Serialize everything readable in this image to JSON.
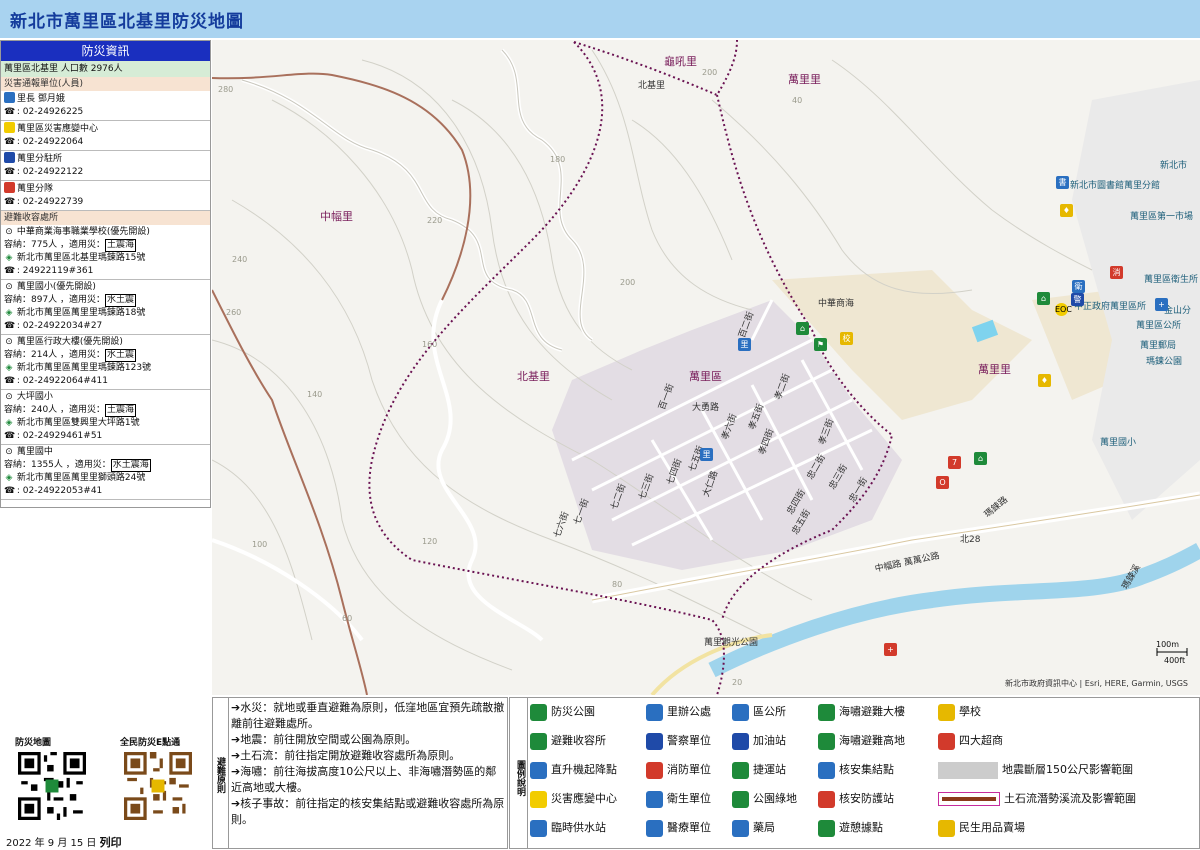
{
  "title": "新北市萬里區北基里防災地圖",
  "panel": {
    "heading": "防災資訊",
    "population": "萬里區北基里  人口數   2976人",
    "report_section": "災害通報單位(人員)",
    "contacts": [
      {
        "name": "里長 鄧月娥",
        "phone": "02-24926225",
        "icon": "village-office-icon",
        "color": "#2a6fc0"
      },
      {
        "name": "萬里區災害應變中心",
        "phone": "02-24922064",
        "icon": "eoc-icon",
        "color": "#f2cc00"
      },
      {
        "name": "萬里分駐所",
        "phone": "02-24922122",
        "icon": "police-icon",
        "color": "#1f4aa8"
      },
      {
        "name": "萬里分隊",
        "phone": "02-24922739",
        "icon": "fire-station-icon",
        "color": "#d23a2b"
      }
    ],
    "shelter_section": "避難收容處所",
    "shelters": [
      {
        "name": "中華商業海事職業學校(優先開設)",
        "capacity": "容納：775人 ，適用災：",
        "hazards": "土震海",
        "address": "新北市萬里區北基里瑪鋉路15號",
        "phone": "24922119#361"
      },
      {
        "name": "萬里國小(優先開設)",
        "capacity": "容納：897人 ，適用災：",
        "hazards": "水土震",
        "address": "新北市萬里區萬里里瑪鋉路18號",
        "phone": "02-24922034#27"
      },
      {
        "name": "萬里區行政大樓(優先開設)",
        "capacity": "容納：214人 ，適用災：",
        "hazards": "水土震",
        "address": "新北市萬里區萬里里瑪鋉路123號",
        "phone": "02-24922064#411"
      },
      {
        "name": "大坪國小",
        "capacity": "容納：240人 ，適用災：",
        "hazards": "土震海",
        "address": "新北市萬里區雙興里大坪路1號",
        "phone": "02-24929461#51"
      },
      {
        "name": "萬里國中",
        "capacity": "容納：1355人 ，適用災：",
        "hazards": "水土震海",
        "address": "新北市萬里區萬里里獅頭路24號",
        "phone": "02-24922053#41"
      }
    ]
  },
  "map": {
    "villages": [
      "龜吼里",
      "萬里里",
      "北基里",
      "中幅里",
      "萬里里",
      "萬里區"
    ],
    "road_labels": [
      "北基里",
      "中幅路 萬萬公路",
      "瑪鋉路",
      "北28",
      "瑪鋉溪",
      "萬里觀光公園",
      "中華商海"
    ],
    "streets": [
      "百二街",
      "百一街",
      "大勇路",
      "孝二街",
      "孝六街",
      "孝五街",
      "孝四街",
      "孝三街",
      "七一街",
      "七二街",
      "七三街",
      "七四街",
      "七五街",
      "七六街",
      "大仁路",
      "忠二街",
      "忠三街",
      "忠四街",
      "忠五街",
      "忠一街"
    ],
    "pois": [
      "新北市圖書館萬里分館",
      "萬里區第一市場",
      "萬里區衛生所",
      "中正政府萬里區所",
      "金山分",
      "萬里區公所",
      "萬里國小",
      "萬里郵局",
      "瑪鍊公園",
      "新北市"
    ],
    "contours": [
      "200",
      "220",
      "240",
      "260",
      "280",
      "200",
      "180",
      "160",
      "140",
      "120",
      "100",
      "80",
      "60",
      "40",
      "20"
    ],
    "scale_m": "100m",
    "scale_ft": "400ft",
    "attribution": "新北市政府資訊中心 | Esri, HERE, Garmin, USGS"
  },
  "qr": {
    "left_label": "防災地圖",
    "right_label": "全民防災E點通"
  },
  "print_date": {
    "date": "2022 年 9 月 15 日",
    "suffix": "列印"
  },
  "principles": {
    "tag": "避難原則",
    "items": [
      "水災：就地或垂直避難為原則，低窪地區宜預先疏散撤離前往避難處所。",
      "地震：前往開放空間或公園為原則。",
      "土石流：前往指定開放避難收容處所為原則。",
      "海嘯：前往海拔高度10公尺以上、非海嘯潛勢區的鄰近高地或大樓。",
      "核子事故：前往指定的核安集結點或避難收容處所為原則。"
    ]
  },
  "legend": {
    "tag": "圖例說明",
    "items": [
      {
        "label": "防災公園",
        "icon": "park-icon",
        "color": "#1e8a3a"
      },
      {
        "label": "里辦公處",
        "icon": "village-office-icon",
        "color": "#2a6fc0"
      },
      {
        "label": "區公所",
        "icon": "district-office-icon",
        "color": "#2a6fc0"
      },
      {
        "label": "海嘯避難大樓",
        "icon": "tsunami-building-icon",
        "color": "#1e8a3a"
      },
      {
        "label": "學校",
        "icon": "school-icon",
        "color": "#e6b800"
      },
      {
        "label": "避難收容所",
        "icon": "shelter-icon",
        "color": "#1e8a3a"
      },
      {
        "label": "警察單位",
        "icon": "police-icon",
        "color": "#1f4aa8"
      },
      {
        "label": "加油站",
        "icon": "gas-station-icon",
        "color": "#1f4aa8"
      },
      {
        "label": "海嘯避難高地",
        "icon": "tsunami-high-ground-icon",
        "color": "#1e8a3a"
      },
      {
        "label": "四大超商",
        "icon": "convenience-store-icon",
        "color": "#d23a2b"
      },
      {
        "label": "直升機起降點",
        "icon": "helicopter-icon",
        "color": "#2a6fc0"
      },
      {
        "label": "消防單位",
        "icon": "fire-station-icon",
        "color": "#d23a2b"
      },
      {
        "label": "捷運站",
        "icon": "metro-icon",
        "color": "#1e8a3a"
      },
      {
        "label": "核安集結點",
        "icon": "nuclear-assembly-icon",
        "color": "#2a6fc0"
      },
      {
        "label": "地震斷層150公尺影響範圍",
        "icon": "fault-zone-icon",
        "color": "#cccccc"
      },
      {
        "label": "災害應變中心",
        "icon": "eoc-icon",
        "color": "#f2cc00"
      },
      {
        "label": "衛生單位",
        "icon": "health-icon",
        "color": "#2a6fc0"
      },
      {
        "label": "公園綠地",
        "icon": "green-space-icon",
        "color": "#1e8a3a"
      },
      {
        "label": "核安防護站",
        "icon": "nuclear-protection-icon",
        "color": "#d23a2b"
      },
      {
        "label": "土石流潛勢溪流及影響範圍",
        "icon": "debris-flow-icon",
        "color": "#8b3a1a"
      },
      {
        "label": "臨時供水站",
        "icon": "water-station-icon",
        "color": "#2a6fc0"
      },
      {
        "label": "醫療單位",
        "icon": "medical-icon",
        "color": "#2a6fc0"
      },
      {
        "label": "藥局",
        "icon": "pharmacy-icon",
        "color": "#2a6fc0"
      },
      {
        "label": "遊憩據點",
        "icon": "recreation-icon",
        "color": "#1e8a3a"
      },
      {
        "label": "民生用品賣場",
        "icon": "supermarket-icon",
        "color": "#e6b800"
      }
    ]
  }
}
